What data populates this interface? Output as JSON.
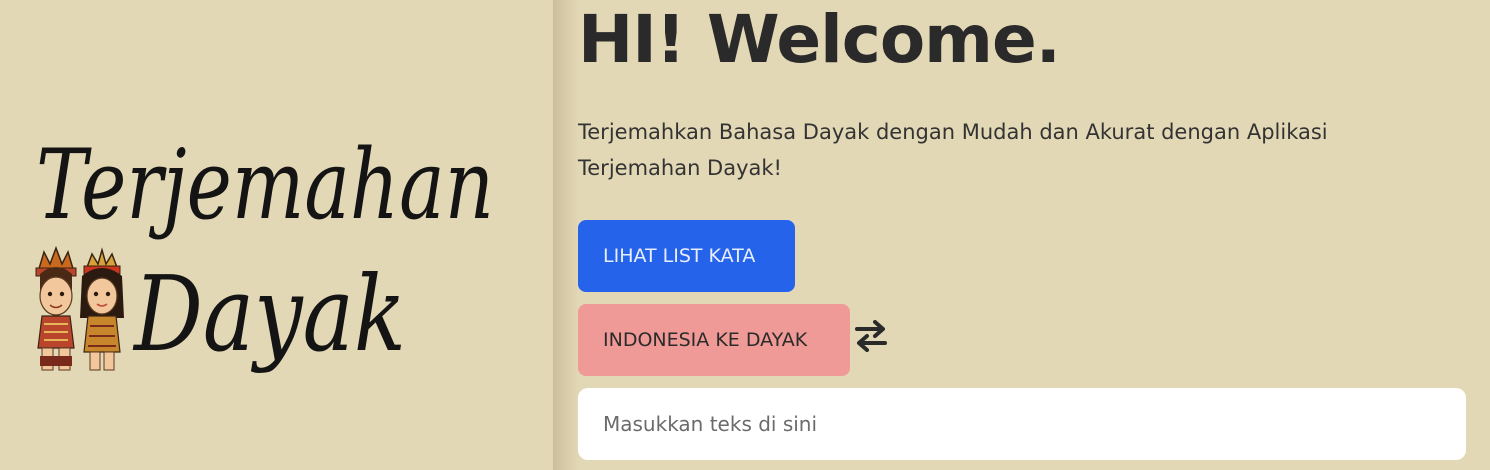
{
  "logo": {
    "line1": "Terjemahan",
    "line2": "Dayak"
  },
  "hero": {
    "title": "HI! Welcome.",
    "subtitle": "Terjemahkan Bahasa Dayak dengan Mudah dan Akurat dengan Aplikasi Terjemahan Dayak!"
  },
  "actions": {
    "list_button": "LIHAT LIST KATA",
    "direction_button": "INDONESIA KE DAYAK",
    "swap_icon": "swap-arrows-icon"
  },
  "translator": {
    "input_placeholder": "Masukkan teks di sini",
    "input_value": ""
  },
  "colors": {
    "background": "#e3d8b6",
    "primary_button": "#2563eb",
    "direction_button": "#ef9a96",
    "input_background": "#ffffff"
  }
}
